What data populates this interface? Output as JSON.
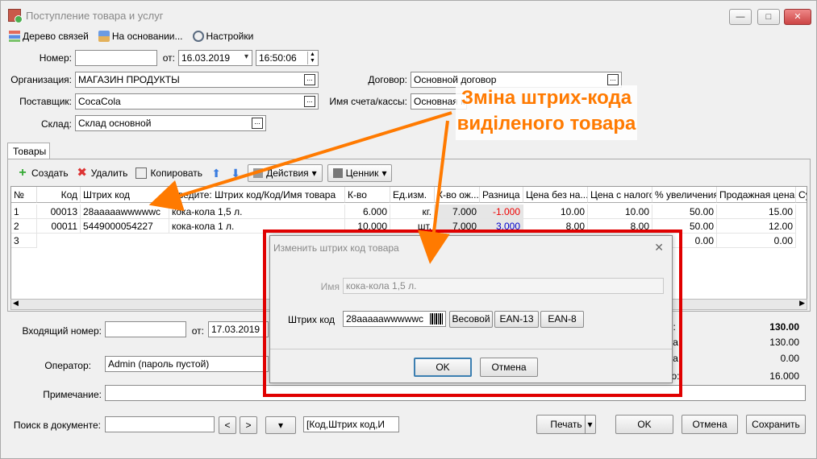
{
  "window": {
    "title": "Поступление товара и услуг",
    "controls": [
      "—",
      "□",
      "✕"
    ]
  },
  "toolbar": {
    "tree": "Дерево связей",
    "basis": "На основании...",
    "settings": "Настройки"
  },
  "header": {
    "number_label": "Номер:",
    "number_value": "",
    "from_label": "от:",
    "date_value": "16.03.2019",
    "time_value": "16:50:06",
    "org_label": "Организация:",
    "org_value": "МАГАЗИН ПРОДУКТЫ",
    "supplier_label": "Поставщик:",
    "supplier_value": "CocaCola",
    "warehouse_label": "Склад:",
    "warehouse_value": "Склад основной",
    "contract_label": "Договор:",
    "contract_value": "Основной договор",
    "account_label": "Имя счета/кассы:",
    "account_value": "Основная к"
  },
  "tabs": {
    "goods": "Товары"
  },
  "goods_toolbar": {
    "create": "Создать",
    "delete": "Удалить",
    "copy": "Копировать",
    "actions": "Действия",
    "price_tag": "Ценник"
  },
  "grid": {
    "columns": [
      "№",
      "Код",
      "Штрих код",
      "Введите: Штрих код/Код/Имя товара",
      "К-во",
      "Ед.изм.",
      "К-во ож...",
      "Разница",
      "Цена без на...",
      "Цена с налогом",
      "% увеличения",
      "Продажная цена",
      "Сум"
    ],
    "rows": [
      [
        "1",
        "00013",
        "28aaaaawwwwwc",
        "кока-кола 1,5 л.",
        "6.000",
        "кг.",
        "7.000",
        "-1.000",
        "10.00",
        "10.00",
        "50.00",
        "15.00"
      ],
      [
        "2",
        "00011",
        "5449000054227",
        "кока-кола 1 л.",
        "10.000",
        "шт.",
        "7.000",
        "3.000",
        "8.00",
        "8.00",
        "50.00",
        "12.00"
      ],
      [
        "3",
        "",
        "",
        "",
        "",
        "",
        "",
        "",
        "",
        "",
        "0.00",
        "0.00"
      ]
    ]
  },
  "footer": {
    "incoming_number_label": "Входящий номер:",
    "incoming_number_value": "",
    "from_label": "от:",
    "incoming_date": "17.03.2019",
    "operator_label": "Оператор:",
    "operator_value": "Admin (пароль пустой)",
    "note_label": "Примечание:",
    "note_value": "",
    "totals": [
      {
        "label": "его:",
        "value": "130.00",
        "bold": true
      },
      {
        "label": "пога:",
        "value": "130.00",
        "bold": false
      },
      {
        "label": "пога:",
        "value": "0.00",
        "bold": false
      },
      {
        "label": "к-во:",
        "value": "16.000",
        "bold": false
      }
    ]
  },
  "bottom": {
    "search_label": "Поиск в документе:",
    "search_value": "",
    "prev": "<",
    "next": ">",
    "search_fields": "[Код,Штрих код,И",
    "print": "Печать",
    "ok": "OK",
    "cancel": "Отмена",
    "save": "Сохранить"
  },
  "dialog": {
    "title": "Изменить штрих код товара",
    "close": "✕",
    "name_label": "Имя",
    "name_value": "кока-кола 1,5 л.",
    "barcode_label": "Штрих код",
    "barcode_value": "28aaaaawwwwwc",
    "weight_btn": "Весовой",
    "ean13_btn": "EAN-13",
    "ean8_btn": "EAN-8",
    "ok": "OK",
    "cancel": "Отмена"
  },
  "annotation": {
    "line1": "Зміна штрих-кода",
    "line2": "виділеного товара",
    "color": "#ff7a00",
    "frame_color": "#e00000"
  }
}
